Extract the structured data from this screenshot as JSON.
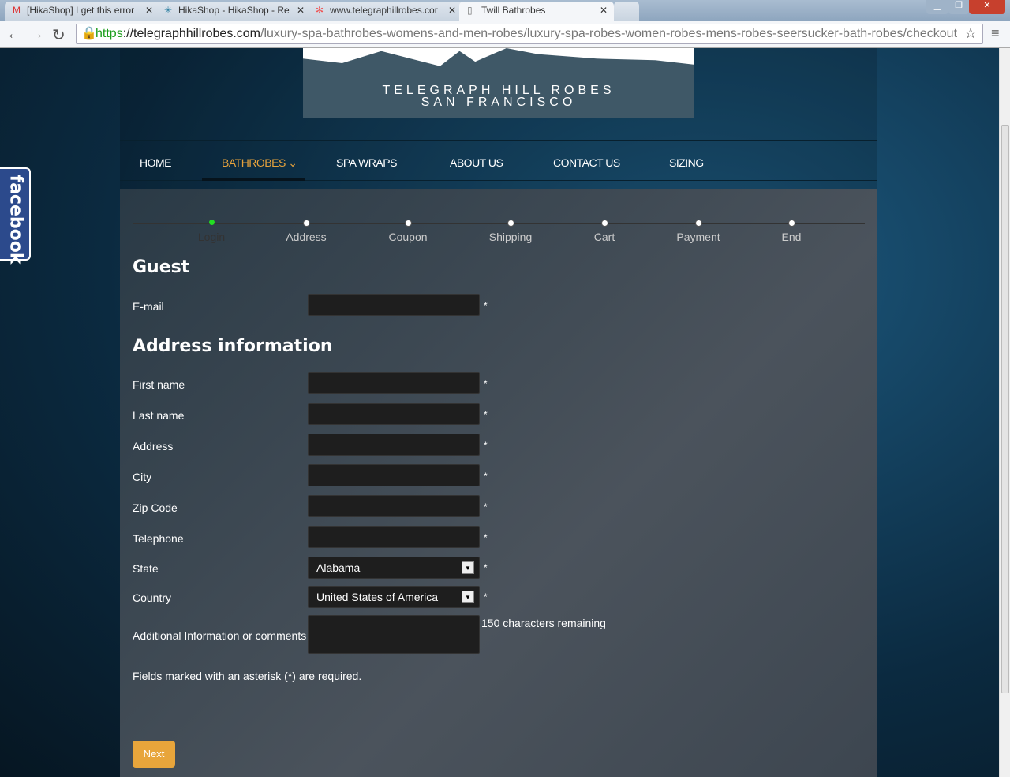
{
  "browser": {
    "tabs": [
      {
        "title": "[HikaShop] I get this error",
        "icon": "gmail-icon"
      },
      {
        "title": "HikaShop - HikaShop - Re",
        "icon": "hikashop-icon"
      },
      {
        "title": "www.telegraphillrobes.cor",
        "icon": "joomla-icon"
      },
      {
        "title": "Twill Bathrobes",
        "icon": "page-icon"
      }
    ],
    "url_scheme": "https",
    "url_domain": "://telegraphhillrobes.com",
    "url_path": "/luxury-spa-bathrobes-womens-and-men-robes/luxury-spa-robes-women-robes-mens-robes-seersucker-bath-robes/checkout"
  },
  "site": {
    "logo_line1": "TELEGRAPH HILL ROBES",
    "logo_line2": "SAN FRANCISCO",
    "facebook": "facebook",
    "menu": [
      "HOME",
      "BATHROBES",
      "SPA WRAPS",
      "ABOUT US",
      "CONTACT US",
      "SIZING"
    ],
    "active_menu": "BATHROBES",
    "accent": "#e6a23c"
  },
  "checkout": {
    "steps": [
      "Login",
      "Address",
      "Coupon",
      "Shipping",
      "Cart",
      "Payment",
      "End"
    ],
    "current_step": "Login",
    "guest_title": "Guest",
    "email_label": "E-mail",
    "address_title": "Address information",
    "fields": [
      "First name",
      "Last name",
      "Address",
      "City",
      "Zip Code",
      "Telephone"
    ],
    "state_label": "State",
    "state_value": "Alabama",
    "country_label": "Country",
    "country_value": "United States of America",
    "comments_label": "Additional Information or comments",
    "chars_remaining": "150 characters remaining",
    "required_note": "Fields marked with an asterisk (*) are required.",
    "asterisk": "*",
    "next_label": "Next"
  }
}
